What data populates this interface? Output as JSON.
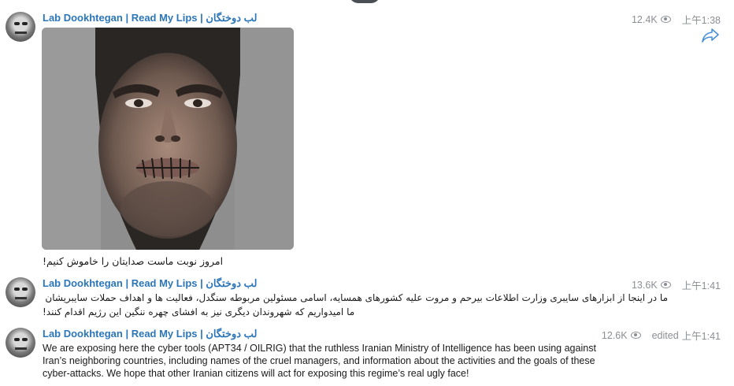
{
  "messages": [
    {
      "sender": "Lab Dookhtegan | Read My Lips | لب دوختگان",
      "views": "12.4K",
      "time": "上午1:38",
      "edited": "",
      "caption": "امروز نوبت ماست صدایتان را خاموش کنیم!"
    },
    {
      "sender": "Lab Dookhtegan | Read My Lips | لب دوختگان",
      "views": "13.6K",
      "time": "上午1:41",
      "edited": "",
      "lines": [
        "ما در اینجا از ابزارهای سایبری وزارت اطلاعات بیرحم و مروت علیه کشورهای همسایه، اسامی مسئولین مربوطه سنگدل، فعالیت ها و اهداف حملات سایبریشان پرده برمی داریم.",
        "ما امیدواریم که شهروندان دیگری نیز به افشای چهره ننگین این رژیم اقدام کنند!"
      ]
    },
    {
      "sender": "Lab Dookhtegan | Read My Lips | لب دوختگان",
      "views": "12.6K",
      "time": "上午1:41",
      "edited": "edited",
      "lines": [
        "We are exposing here the cyber tools (APT34 / OILRIG) that the ruthless Iranian Ministry of Intelligence has been using against",
        "Iran’s neighboring countries, including names of the cruel managers, and information about the activities and the goals of these",
        "cyber-attacks.  We hope that other Iranian citizens will act for exposing this regime’s real ugly face!"
      ]
    }
  ],
  "icons": {
    "views": "eye-icon",
    "forward": "share-arrow-icon",
    "avatar": "channel-avatar"
  },
  "colors": {
    "sender": "#2b76b9",
    "meta": "#8a8f95",
    "share": "#4a90d9"
  }
}
